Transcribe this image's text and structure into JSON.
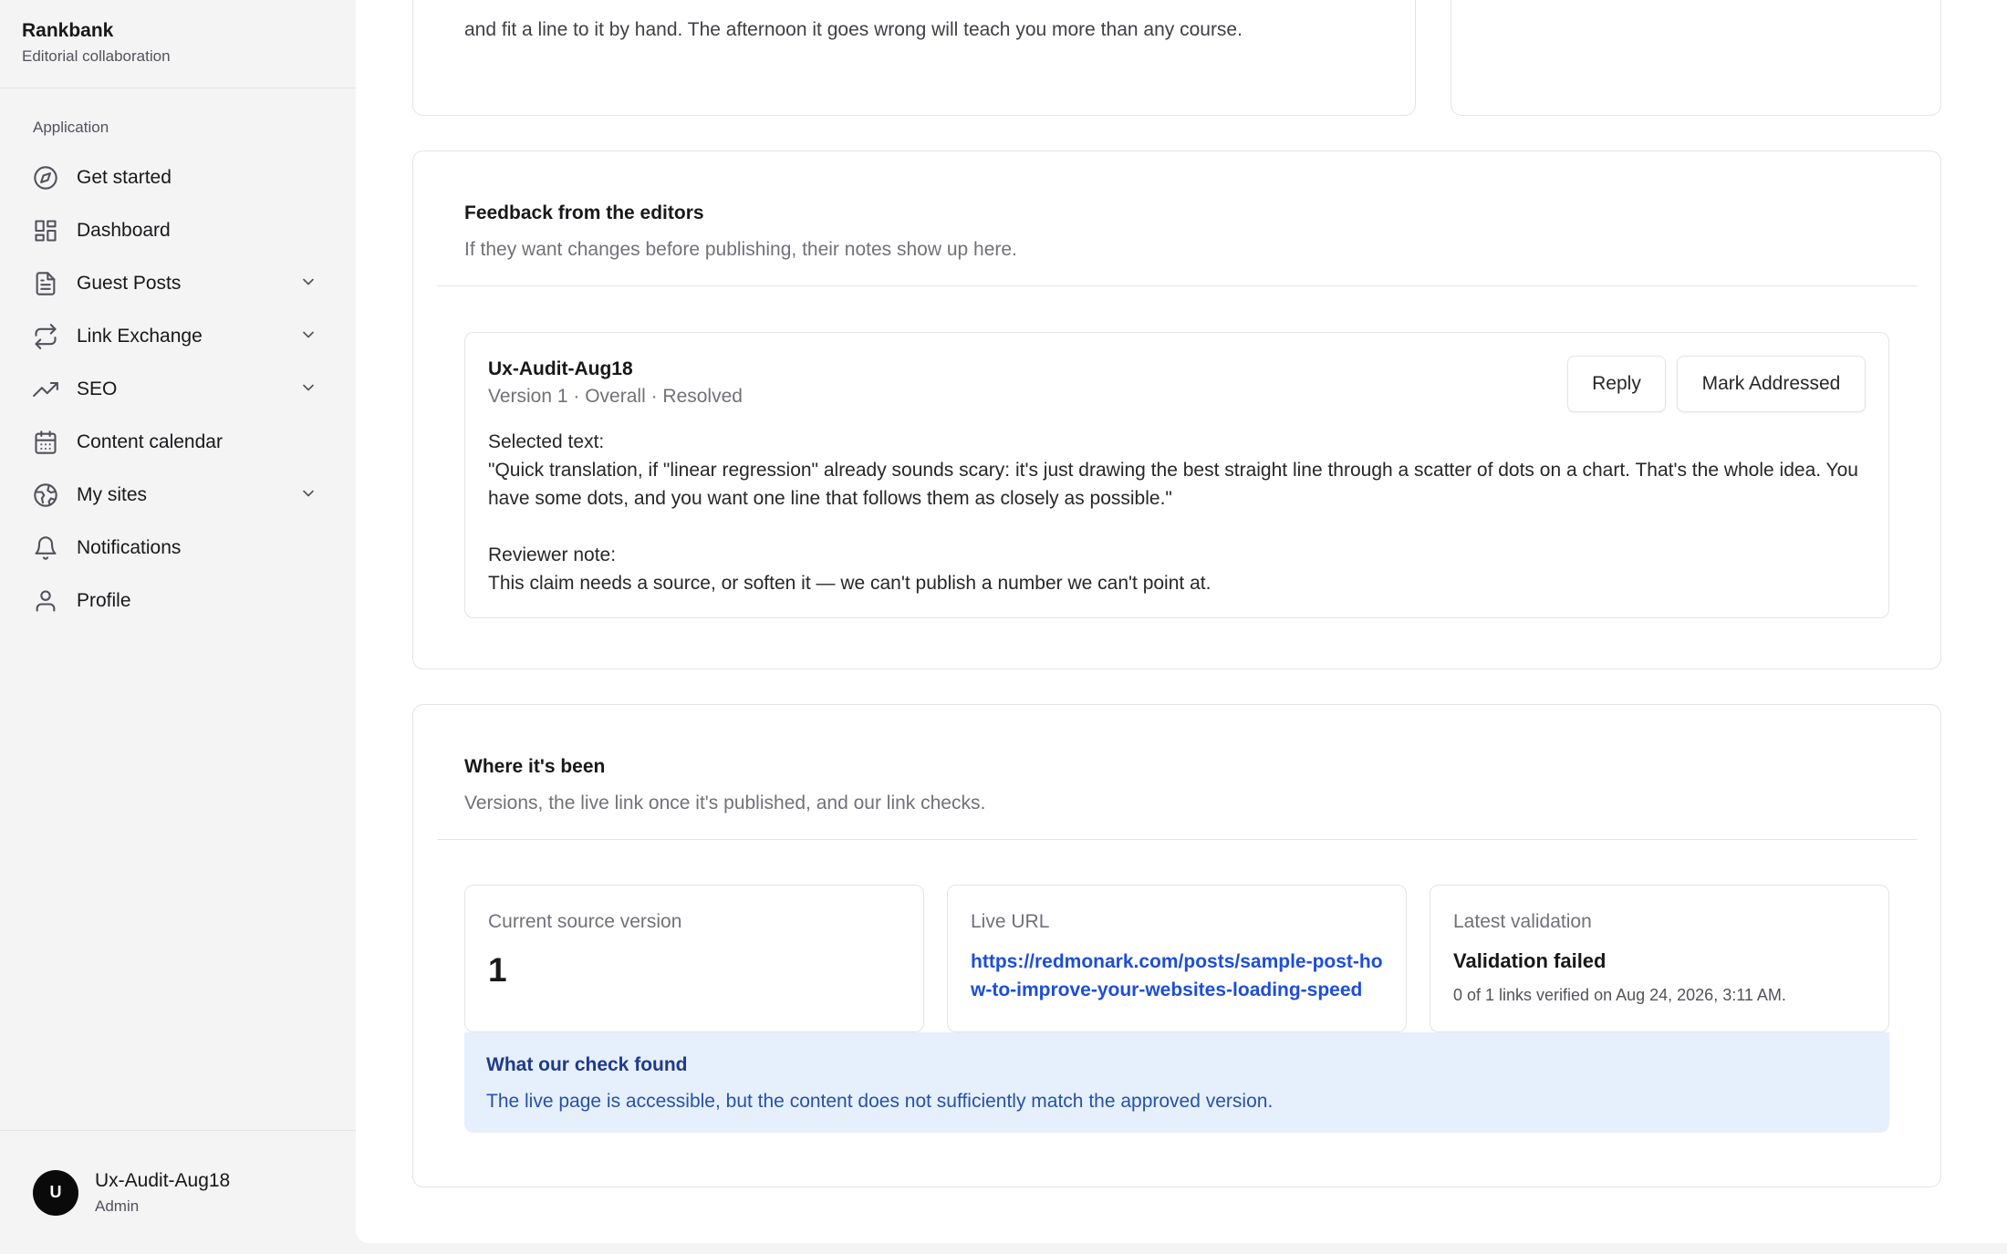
{
  "brand": {
    "name": "Rankbank",
    "subtitle": "Editorial collaboration"
  },
  "sidebar": {
    "section": "Application",
    "items": [
      {
        "label": "Get started",
        "icon": "compass-icon",
        "expandable": false
      },
      {
        "label": "Dashboard",
        "icon": "grid-icon",
        "expandable": false
      },
      {
        "label": "Guest Posts",
        "icon": "document-icon",
        "expandable": true
      },
      {
        "label": "Link Exchange",
        "icon": "repeat-icon",
        "expandable": true
      },
      {
        "label": "SEO",
        "icon": "trending-up-icon",
        "expandable": true
      },
      {
        "label": "Content calendar",
        "icon": "calendar-icon",
        "expandable": false
      },
      {
        "label": "My sites",
        "icon": "globe-icon",
        "expandable": true
      },
      {
        "label": "Notifications",
        "icon": "bell-icon",
        "expandable": false
      },
      {
        "label": "Profile",
        "icon": "user-icon",
        "expandable": false
      }
    ]
  },
  "user": {
    "initial": "U",
    "name": "Ux-Audit-Aug18",
    "role": "Admin"
  },
  "article": {
    "visible_text": "and fit a line to it by hand. The afternoon it goes wrong will teach you more than any course."
  },
  "feedback": {
    "title": "Feedback from the editors",
    "subtitle": "If they want changes before publishing, their notes show up here.",
    "comment": {
      "author": "Ux-Audit-Aug18",
      "meta": "Version 1 · Overall · Resolved",
      "selected_label": "Selected text:",
      "selected_text": "\"Quick translation, if \"linear regression\" already sounds scary: it's just drawing the best straight line through a scatter of dots on a chart. That's the whole idea. You have some dots, and you want one line that follows them as closely as possible.\"",
      "note_label": "Reviewer note:",
      "note_text": "This claim needs a source, or soften it — we can't publish a number we can't point at.",
      "reply_label": "Reply",
      "mark_label": "Mark Addressed"
    }
  },
  "where": {
    "title": "Where it's been",
    "subtitle": "Versions, the live link once it's published, and our link checks.",
    "version_label": "Current source version",
    "version_value": "1",
    "live_label": "Live URL",
    "live_url": "https://redmonark.com/posts/sample-post-how-to-improve-your-websites-loading-speed",
    "validation_label": "Latest validation",
    "validation_status": "Validation failed",
    "validation_detail": "0 of 1 links verified on Aug 24, 2026, 3:11 AM.",
    "alert_title": "What our check found",
    "alert_text": "The live page is accessible, but the content does not sufficiently match the approved version."
  },
  "colors": {
    "link": "#1d4ed8",
    "alert_bg": "#e6effc",
    "alert_title": "#1e3a8a",
    "avatar": "#0a0a0a"
  }
}
